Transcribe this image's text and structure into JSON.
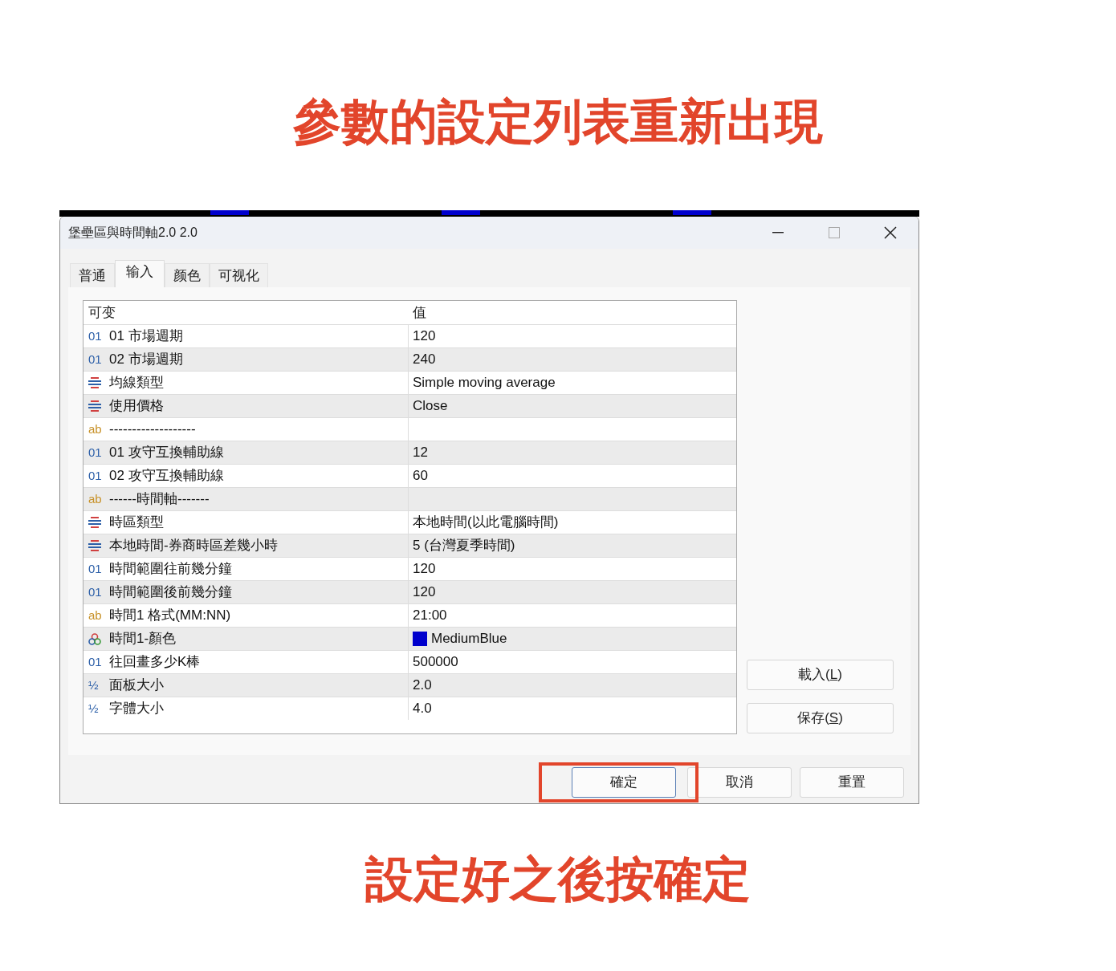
{
  "heading": "參數的設定列表重新出現",
  "window": {
    "title": "堡壘區與時間軸2.0 2.0"
  },
  "tabs": [
    {
      "label": "普通",
      "selected": false
    },
    {
      "label": "输入",
      "selected": true
    },
    {
      "label": "颜色",
      "selected": false
    },
    {
      "label": "可视化",
      "selected": false
    }
  ],
  "table": {
    "columns": [
      "可变",
      "值"
    ],
    "rows": [
      {
        "kind": "int",
        "badge": "01",
        "name": "01 市場週期",
        "value": "120"
      },
      {
        "kind": "int",
        "badge": "01",
        "name": "02 市場週期",
        "value": "240"
      },
      {
        "kind": "enum",
        "name": "均線類型",
        "value": "Simple moving average"
      },
      {
        "kind": "enum",
        "name": "使用價格",
        "value": "Close"
      },
      {
        "kind": "string",
        "badge": "ab",
        "name": "-------------------"
      },
      {
        "kind": "int",
        "badge": "01",
        "name": "01 攻守互換輔助線",
        "value": "12"
      },
      {
        "kind": "int",
        "badge": "01",
        "name": "02 攻守互換輔助線",
        "value": "60"
      },
      {
        "kind": "string",
        "badge": "ab",
        "name": "------時間軸-------"
      },
      {
        "kind": "enum",
        "name": "時區類型",
        "value": "本地時間(以此電腦時間)"
      },
      {
        "kind": "enum",
        "name": "本地時間-券商時區差幾小時",
        "value": "5 (台灣夏季時間)"
      },
      {
        "kind": "int",
        "badge": "01",
        "name": "時間範圍往前幾分鐘",
        "value": "120"
      },
      {
        "kind": "int",
        "badge": "01",
        "name": "時間範圍後前幾分鐘",
        "value": "120"
      },
      {
        "kind": "string",
        "badge": "ab",
        "name": "時間1 格式(MM:NN)",
        "value": "21:00"
      },
      {
        "kind": "color",
        "name": "時間1-顏色",
        "value": "MediumBlue",
        "color": "#0000cd"
      },
      {
        "kind": "int",
        "badge": "01",
        "name": "往回畫多少K棒",
        "value": "500000"
      },
      {
        "kind": "double",
        "badge": "½",
        "name": "面板大小",
        "value": "2.0"
      },
      {
        "kind": "double",
        "badge": "½",
        "name": "字體大小",
        "value": "4.0"
      }
    ]
  },
  "side_buttons": [
    {
      "label": "載入(",
      "key": "L",
      "label_end": ")"
    },
    {
      "label": "保存(",
      "key": "S",
      "label_end": ")"
    }
  ],
  "footer_buttons": [
    {
      "label": "確定",
      "highlighted": true
    },
    {
      "label": "取消",
      "highlighted": false
    },
    {
      "label": "重置",
      "highlighted": false
    }
  ],
  "caption": "設定好之後按確定"
}
